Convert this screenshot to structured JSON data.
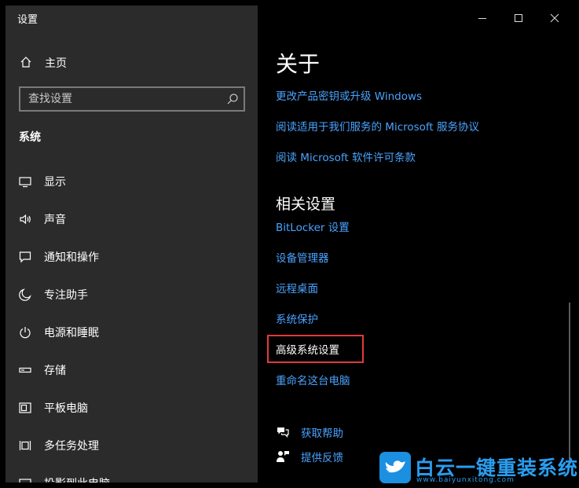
{
  "window": {
    "title": "设置"
  },
  "sidebar": {
    "home_label": "主页",
    "search_placeholder": "查找设置",
    "section_label": "系统",
    "items": [
      {
        "label": "显示",
        "icon": "monitor-icon"
      },
      {
        "label": "声音",
        "icon": "speaker-icon"
      },
      {
        "label": "通知和操作",
        "icon": "message-icon"
      },
      {
        "label": "专注助手",
        "icon": "moon-icon"
      },
      {
        "label": "电源和睡眠",
        "icon": "power-icon"
      },
      {
        "label": "存储",
        "icon": "storage-icon"
      },
      {
        "label": "平板电脑",
        "icon": "tablet-icon"
      },
      {
        "label": "多任务处理",
        "icon": "multitask-icon"
      },
      {
        "label": "投影到此电脑",
        "icon": "projector-icon"
      }
    ]
  },
  "main": {
    "title": "关于",
    "links": [
      "更改产品密钥或升级 Windows",
      "阅读适用于我们服务的 Microsoft 服务协议",
      "阅读 Microsoft 软件许可条款"
    ],
    "related_title": "相关设置",
    "related_links": [
      "BitLocker 设置",
      "设备管理器",
      "远程桌面",
      "系统保护",
      "高级系统设置",
      "重命名这台电脑"
    ],
    "help_label": "获取帮助",
    "feedback_label": "提供反馈"
  },
  "watermark": {
    "title": "白云一键重装系统",
    "url": "www.baiyunxitong.com"
  },
  "colors": {
    "accent": "#4aa3ff",
    "highlight": "#e23a3a",
    "sidebar_bg": "#2b2b2b"
  }
}
